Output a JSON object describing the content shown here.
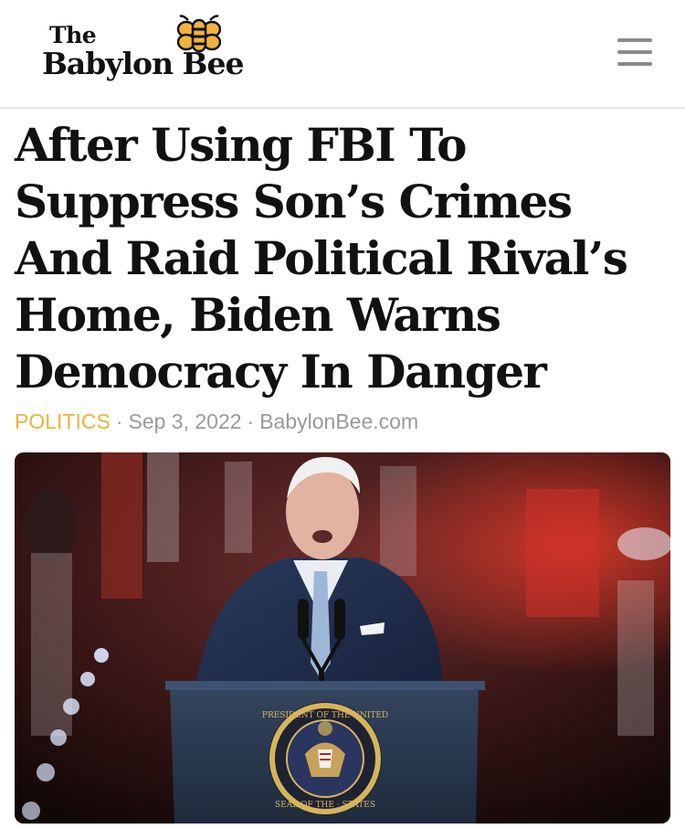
{
  "header": {
    "logo_small": "The",
    "logo_name": "Babylon Bee",
    "menu_icon": "hamburger-menu-icon"
  },
  "article": {
    "headline": "After Using FBI To Suppress Son’s Crimes And Raid Political Rival’s Home, Biden Warns Democracy In Danger",
    "category": "POLITICS",
    "separator": "·",
    "date": "Sep 3, 2022",
    "source": "BabylonBee.com",
    "image": {
      "seal_text_top": "PRESIDENT OF THE UNITED",
      "seal_text_bottom": "SEAL OF THE · STATES"
    }
  },
  "colors": {
    "category": "#e8b43a",
    "meta": "#9a9a9a",
    "bee": "#f2b33d",
    "podium": "#2b3a52"
  }
}
